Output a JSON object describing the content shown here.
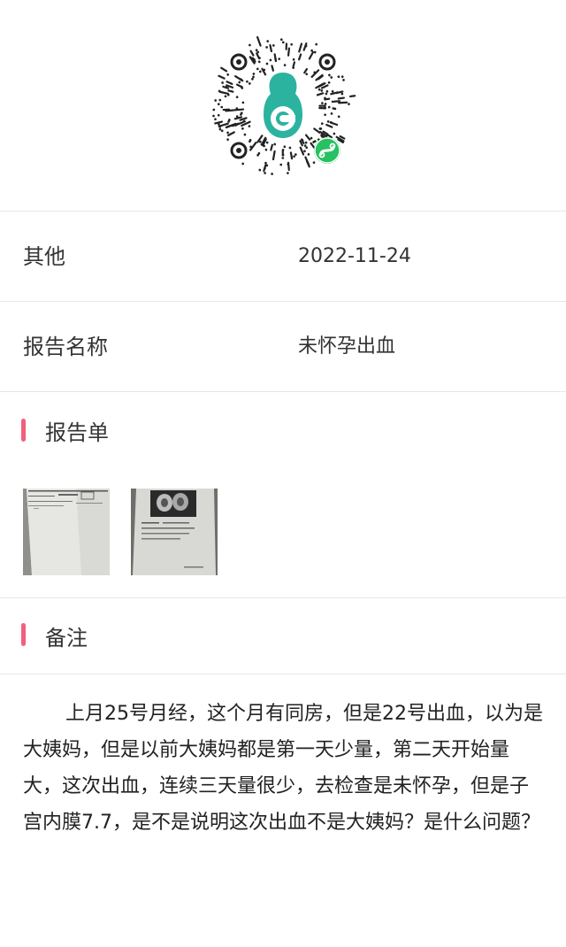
{
  "qr": {
    "icon": "mini-program-qr-code",
    "badge_icon": "mini-program-badge-icon"
  },
  "info_rows": [
    {
      "label": "其他",
      "value": "2022-11-24"
    },
    {
      "label": "报告名称",
      "value": "未怀孕出血"
    }
  ],
  "report_section": {
    "title": "报告单",
    "images": [
      {
        "name": "report-image-1"
      },
      {
        "name": "report-image-2"
      }
    ]
  },
  "notes_section": {
    "title": "备注",
    "text": "上月25号月经，这个月有同房，但是22号出血，以为是大姨妈，但是以前大姨妈都是第一天少量，第二天开始量大，这次出血，连续三天量很少，去检查是未怀孕，但是子宫内膜7.7，是不是说明这次出血不是大姨妈？是什么问题？"
  },
  "colors": {
    "accent": "#f0607c",
    "qr_teal": "#2bb39f",
    "badge_green": "#27c062",
    "divider": "#e6e6e6"
  }
}
